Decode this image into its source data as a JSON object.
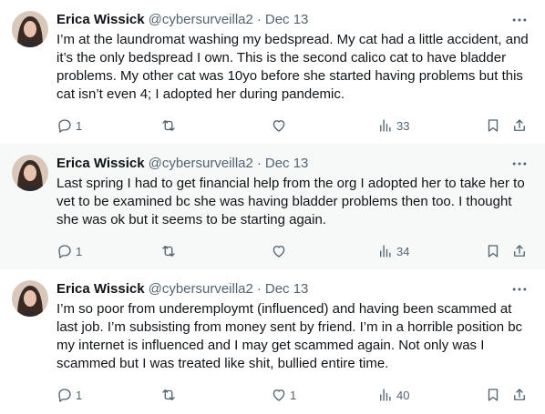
{
  "tweets": [
    {
      "name": "Erica Wissick",
      "handle": "@cybersurveilla2",
      "separator": "·",
      "date": "Dec 13",
      "text": "I’m at the laundromat washing my bedspread. My cat had a little accident, and it’s the only bedspread I own. This is the second calico cat to have bladder problems. My other cat was 10yo before she started having problems but this cat isn’t even 4; I adopted her during pandemic.",
      "replies": "1",
      "retweets": "",
      "likes": "",
      "views": "33"
    },
    {
      "name": "Erica Wissick",
      "handle": "@cybersurveilla2",
      "separator": "·",
      "date": "Dec 13",
      "text": "Last spring I had to get financial help from the org I adopted her to take her to vet to be examined bc she was having bladder problems then too. I thought she was ok but it seems to be starting again.",
      "replies": "1",
      "retweets": "",
      "likes": "",
      "views": "34"
    },
    {
      "name": "Erica Wissick",
      "handle": "@cybersurveilla2",
      "separator": "·",
      "date": "Dec 13",
      "text": "I’m so poor from underemploymt (influenced) and having been scammed at last job. I’m subsisting from money sent by friend. I’m in a horrible position bc my internet is influenced and I may get scammed again. Not only was I scammed but I was treated like shit, bullied entire time.",
      "replies": "1",
      "retweets": "",
      "likes": "1",
      "views": "40"
    }
  ],
  "colors": {
    "text": "#0f1419",
    "secondary": "#536471",
    "thread_line": "#cfd9de",
    "highlight_bg": "#f7f9f9"
  },
  "icons": [
    "more-icon",
    "reply-icon",
    "retweet-icon",
    "like-icon",
    "views-icon",
    "bookmark-icon",
    "share-icon"
  ]
}
